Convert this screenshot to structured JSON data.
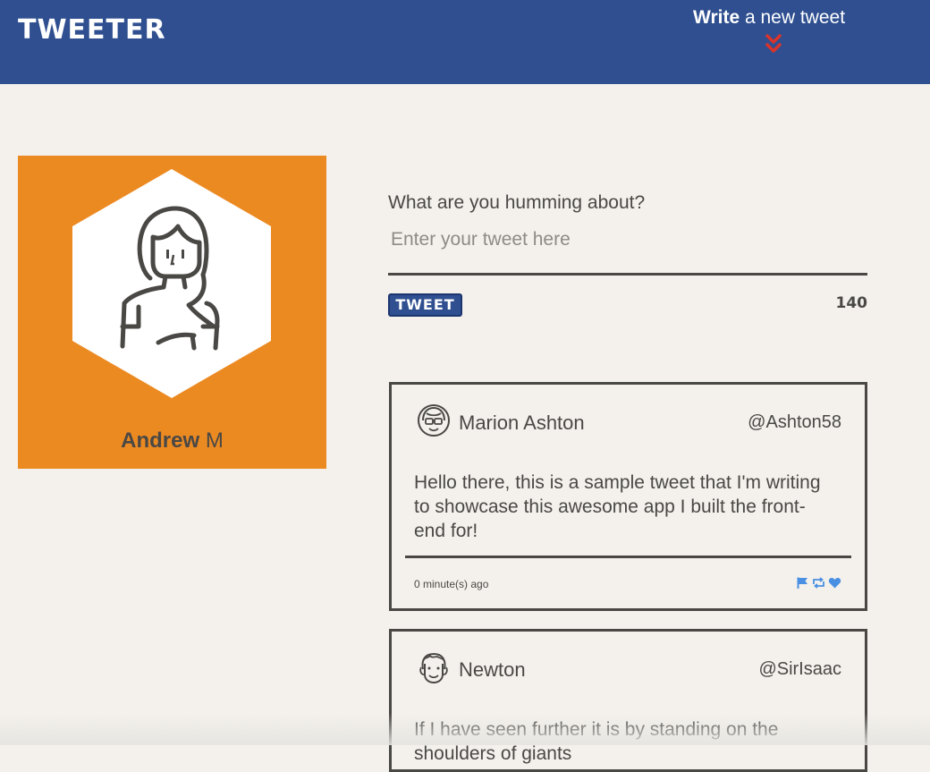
{
  "header": {
    "logo": "TWEETER",
    "compose_toggle_bold": "Write",
    "compose_toggle_rest": " a new tweet"
  },
  "profile": {
    "first_name": "Andrew",
    "last_name": "M"
  },
  "composer": {
    "prompt": "What are you humming about?",
    "placeholder": "Enter your tweet here",
    "value": "",
    "button_label": "TWEET",
    "counter": "140"
  },
  "tweets": [
    {
      "name": "Marion Ashton",
      "handle": "@Ashton58",
      "content": "Hello there, this is a sample tweet that I'm writing to showcase this awesome app I built the front-end for!",
      "time": "0 minute(s) ago",
      "icons": [
        "flag-icon",
        "retweet-icon",
        "heart-icon"
      ]
    },
    {
      "name": "Newton",
      "handle": "@SirIsaac",
      "content": "If I have seen further it is by standing on the shoulders of giants"
    }
  ],
  "colors": {
    "header_bg": "#2f4f90",
    "profile_bg": "#ec8a22",
    "page_bg": "#f4f1ec",
    "accent_red": "#d9342b",
    "icon_blue": "#4a90e2",
    "text": "#4a4845"
  }
}
